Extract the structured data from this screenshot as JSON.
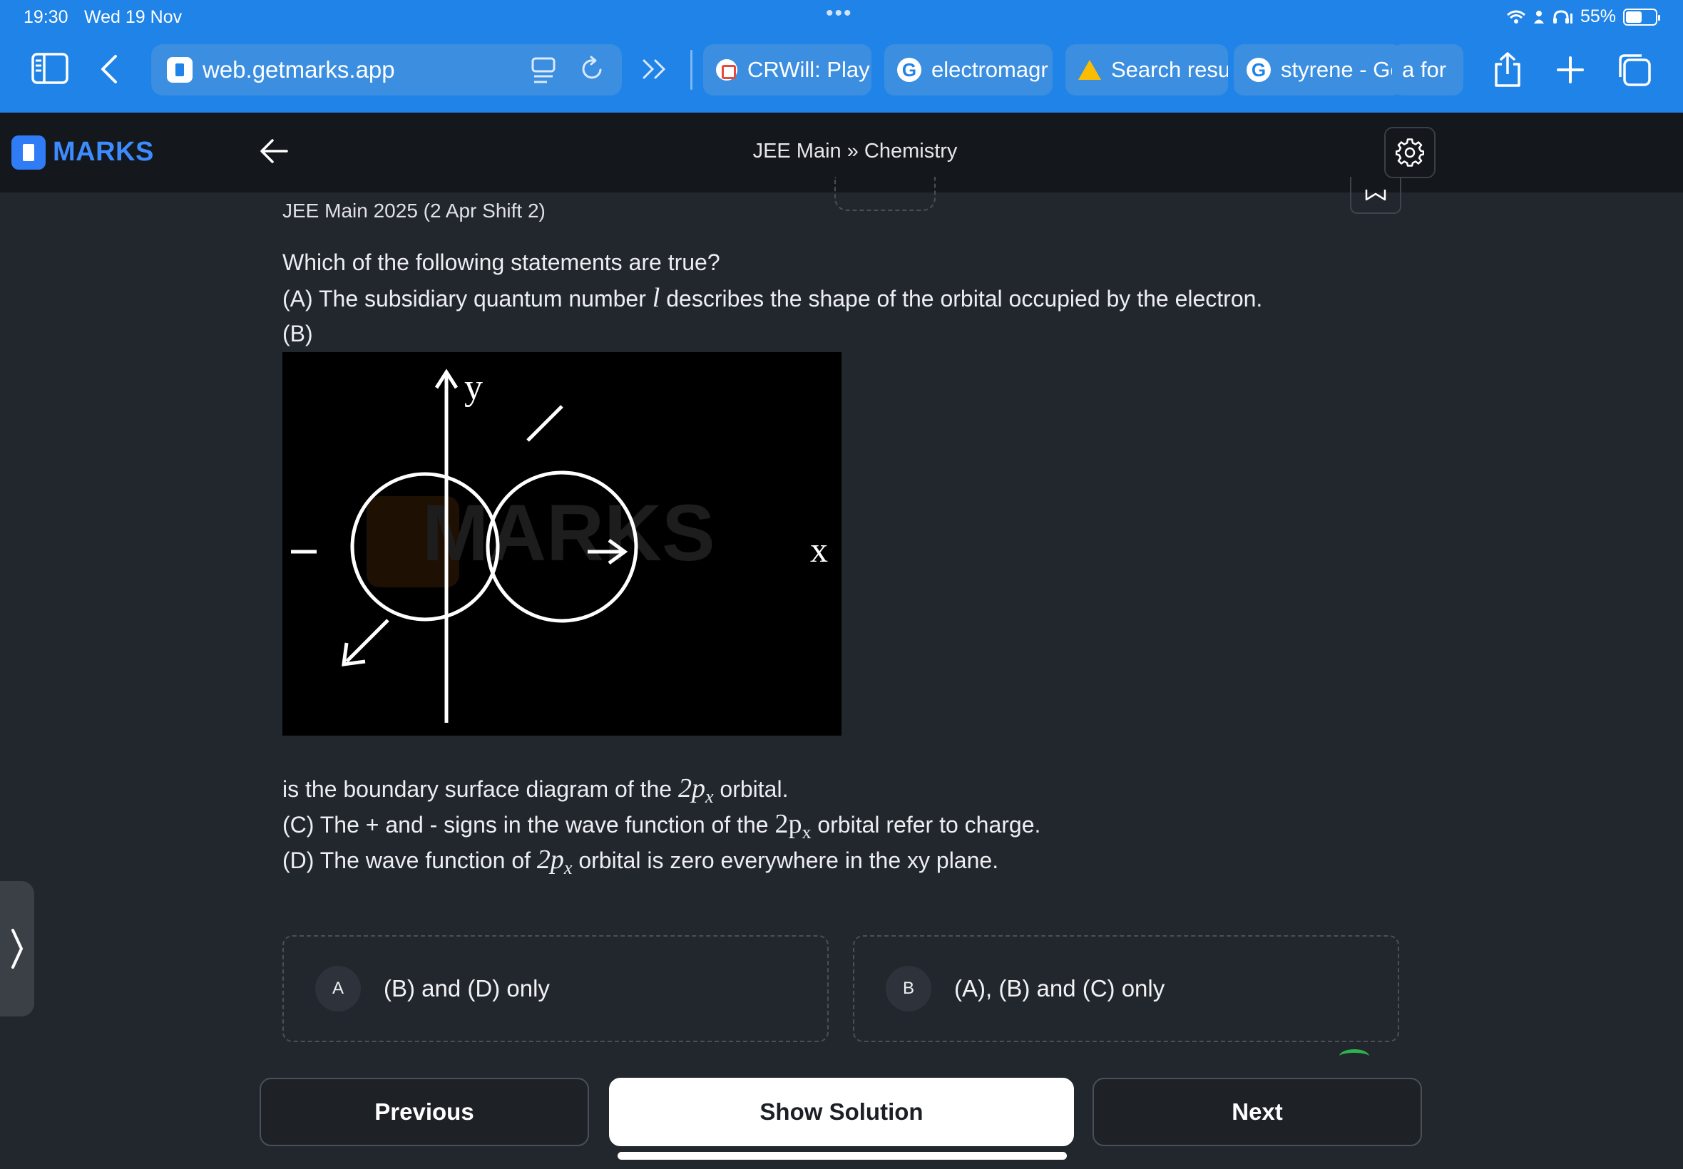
{
  "status_bar": {
    "time": "19:30",
    "date": "Wed 19 Nov",
    "dots": "•••",
    "battery": "55%"
  },
  "browser": {
    "url": "web.getmarks.app",
    "tabs": [
      {
        "label": "CRWill: Play",
        "icon": "crwill-icon"
      },
      {
        "label": "electromagr",
        "icon": "google-icon"
      },
      {
        "label": "Search resu",
        "icon": "google-drive-icon"
      },
      {
        "label": "styrene - Gc",
        "icon": "google-icon"
      },
      {
        "label": "a for",
        "icon": "none"
      }
    ]
  },
  "header": {
    "brand": "MARKS",
    "breadcrumb": "JEE Main » Chemistry"
  },
  "question": {
    "source": "JEE Main 2025 (2 Apr Shift 2)",
    "prompt": "Which of the following statements are true?",
    "a_prefix": "(A) The subsidiary quantum number ",
    "a_symbol": "l",
    "a_suffix": " describes the shape of the orbital occupied by the electron.",
    "b_label": "(B)",
    "b_cont_prefix": "is the boundary surface diagram of the ",
    "b_cont_suffix": " orbital.",
    "c_prefix": "(C) The + and - signs in the wave function of the ",
    "c_suffix": " orbital refer to charge.",
    "d_prefix": "(D) The wave function of ",
    "d_suffix": " orbital is zero everywhere in the xy plane.",
    "orbital_main": "2p",
    "orbital_sub": "x",
    "diagram": {
      "y_label": "y",
      "x_label": "x",
      "watermark": "MARKS"
    }
  },
  "options": [
    {
      "letter": "A",
      "text": "(B) and (D) only"
    },
    {
      "letter": "B",
      "text": "(A), (B) and (C) only"
    }
  ],
  "nav": {
    "previous": "Previous",
    "show_solution": "Show Solution",
    "next": "Next"
  }
}
